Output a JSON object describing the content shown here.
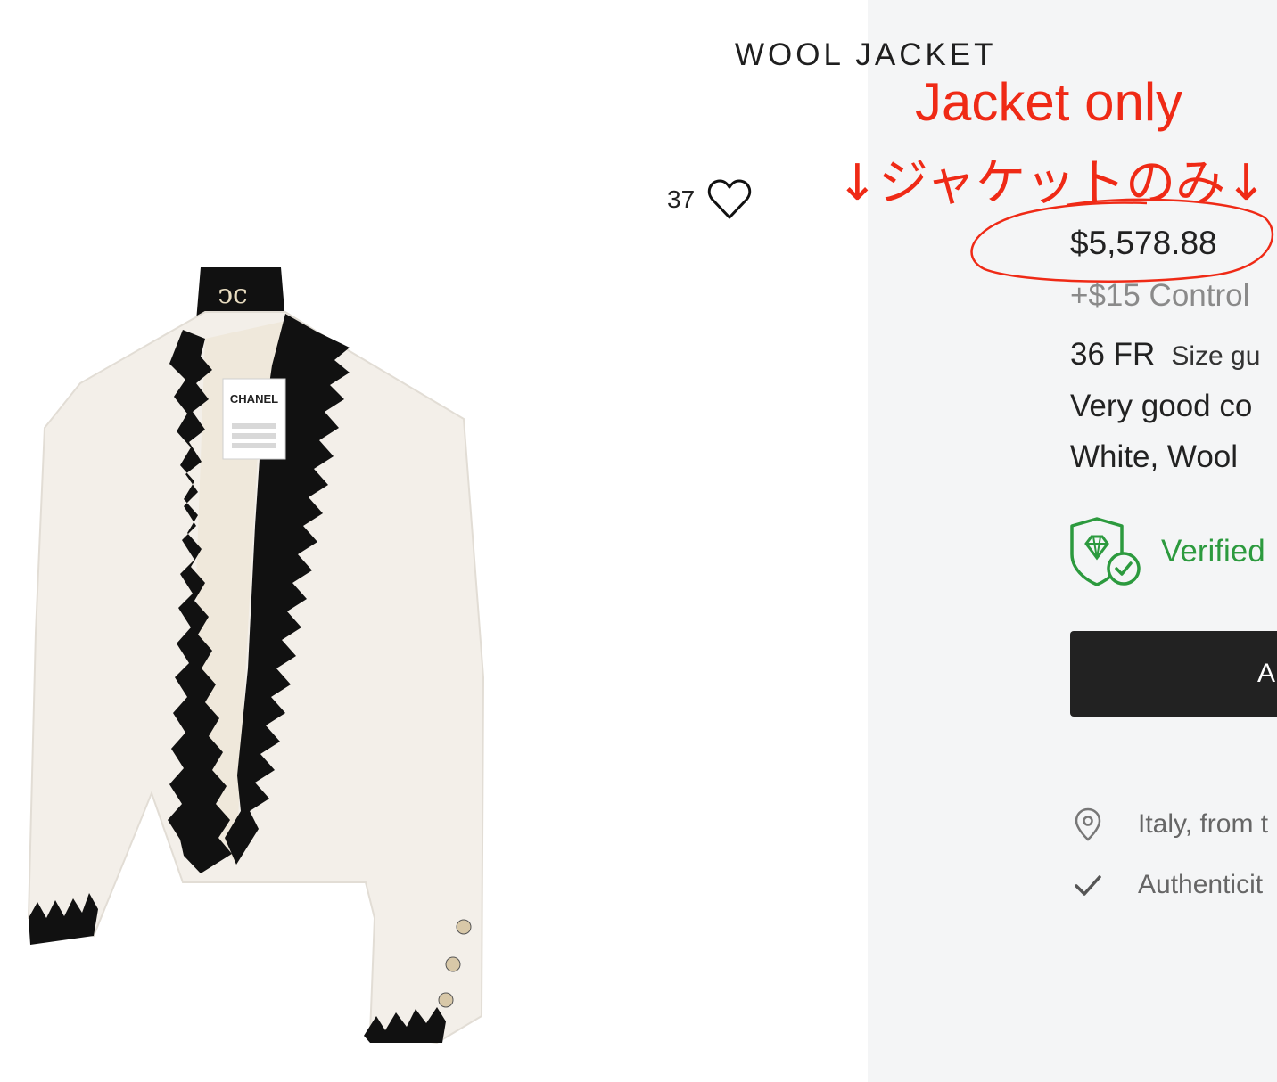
{
  "product": {
    "title": "WOOL JACKET",
    "favorites_count": "37",
    "price": "$5,578.88",
    "extra_fee": "+$15 Control",
    "size": "36 FR",
    "size_guide_label": "Size gu",
    "condition": "Very good co",
    "material": "White, Wool",
    "verified_label": "Verified",
    "add_button_label": "A",
    "location": "Italy, from t",
    "authenticity": "Authenticit",
    "label_brand": "CHANEL"
  },
  "annotations": {
    "english": "Jacket only",
    "japanese": "↓ジャケットのみ↓"
  },
  "icons": {
    "heart": "heart-icon",
    "verified": "shield-diamond-check-icon",
    "location": "map-pin-icon",
    "authenticity": "checkmark-icon"
  },
  "colors": {
    "annotation_red": "#ef2a16",
    "verified_green": "#2c9a3e",
    "button_dark": "#222222",
    "panel_bg": "#f4f5f6"
  }
}
